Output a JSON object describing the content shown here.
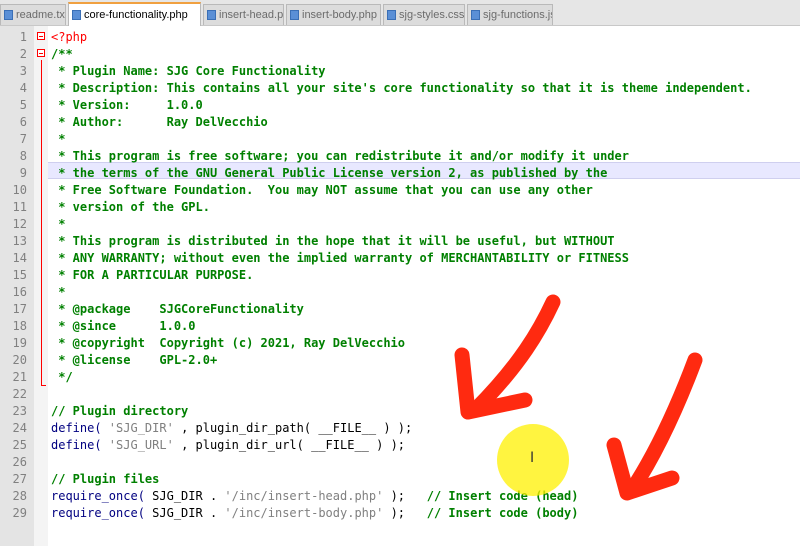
{
  "tabs": [
    {
      "label": "readme.txt",
      "active": false
    },
    {
      "label": "core-functionality.php",
      "active": true
    },
    {
      "label": "insert-head.php",
      "active": false
    },
    {
      "label": "insert-body.php",
      "active": false
    },
    {
      "label": "sjg-styles.css",
      "active": false
    },
    {
      "label": "sjg-functions.js",
      "active": false
    }
  ],
  "line_numbers": [
    "1",
    "2",
    "3",
    "4",
    "5",
    "6",
    "7",
    "8",
    "9",
    "10",
    "11",
    "12",
    "13",
    "14",
    "15",
    "16",
    "17",
    "18",
    "19",
    "20",
    "21",
    "22",
    "23",
    "24",
    "25",
    "26",
    "27",
    "28",
    "29"
  ],
  "lines": {
    "l1": "<?php",
    "l2": "/**",
    "l3": " * Plugin Name: SJG Core Functionality",
    "l4": " * Description: This contains all your site's core functionality so that it is theme independent.",
    "l5": " * Version:     1.0.0",
    "l6": " * Author:      Ray DelVecchio",
    "l7": " *",
    "l8": " * This program is free software; you can redistribute it and/or modify it under",
    "l9": " * the terms of the GNU General Public License version 2, as published by the",
    "l10": " * Free Software Foundation.  You may NOT assume that you can use any other",
    "l11": " * version of the GPL.",
    "l12": " *",
    "l13": " * This program is distributed in the hope that it will be useful, but WITHOUT",
    "l14": " * ANY WARRANTY; without even the implied warranty of MERCHANTABILITY or FITNESS",
    "l15": " * FOR A PARTICULAR PURPOSE.",
    "l16": " *",
    "l17": " * @package    SJGCoreFunctionality",
    "l18": " * @since      1.0.0",
    "l19": " * @copyright  Copyright (c) 2021, Ray DelVecchio",
    "l20": " * @license    GPL-2.0+",
    "l21": " */",
    "l23": "// Plugin directory",
    "l24": {
      "fn": "define(",
      "s1": " 'SJG_DIR' ",
      "mid": ", plugin_dir_path( __FILE__ ) );"
    },
    "l25": {
      "fn": "define(",
      "s1": " 'SJG_URL' ",
      "mid": ", plugin_dir_url( __FILE__ ) );"
    },
    "l27": "// Plugin files",
    "l28": {
      "fn": "require_once(",
      "c": " SJG_DIR . ",
      "s": "'/inc/insert-head.php'",
      "e": " );",
      "cm": "   // Insert code (head)"
    },
    "l29": {
      "fn": "require_once(",
      "c": " SJG_DIR . ",
      "s": "'/inc/insert-body.php'",
      "e": " );",
      "cm": "   // Insert code (body)"
    }
  },
  "colors": {
    "comment": "#008000",
    "php_tag": "#ff0000",
    "function": "#000080",
    "string": "#808080",
    "arrow": "#ff2a10",
    "highlight_circle": "#fff000",
    "current_line": "#e8e8ff"
  },
  "cursor": "I"
}
